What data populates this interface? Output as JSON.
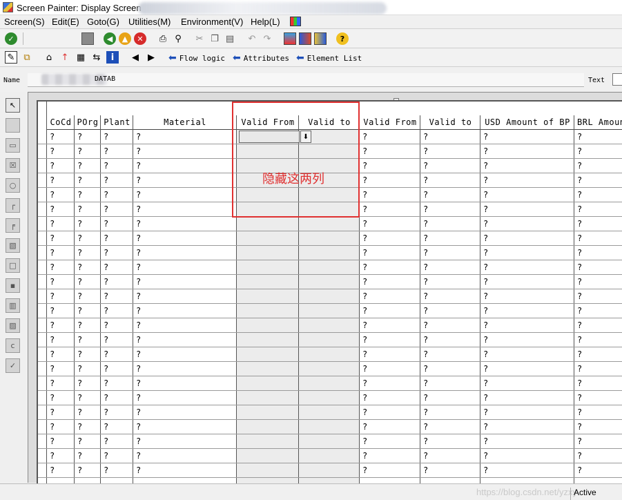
{
  "window": {
    "title": "Screen Painter: Display Screen"
  },
  "menu": [
    "Screen(S)",
    "Edit(E)",
    "Goto(G)",
    "Utilities(M)",
    "Environment(V)",
    "Help(L)"
  ],
  "toolbar2": {
    "flow_logic": "Flow logic",
    "attributes": "Attributes",
    "element_list": "Element List"
  },
  "nameline": {
    "label": "Name",
    "value": "DATAB",
    "text_label": "Text"
  },
  "table": {
    "columns": [
      "CoCd",
      "POrg",
      "Plant",
      "Material",
      "Valid From",
      "Valid to",
      "Valid From",
      "Valid to",
      "USD Amount of BP",
      "BRL Amount"
    ],
    "placeholder": "?",
    "row_count": 24,
    "hidden_columns_note": "隐藏这两列"
  },
  "status": {
    "active": "Active",
    "watermark": "https://blog.csdn.net/yzxy"
  },
  "icons": {
    "toolbar1": [
      "check-icon",
      "save-icon",
      "back-icon",
      "exit-icon",
      "cancel-icon",
      "print-icon",
      "find-icon",
      "cut-icon",
      "copy-icon",
      "paste-icon",
      "undo-icon",
      "redo-icon",
      "layout-icon",
      "display-icon",
      "graphic-icon",
      "help-icon"
    ],
    "palette": [
      "pointer-icon",
      "text-field-icon",
      "input-field-icon",
      "checkbox-icon",
      "radio-button-icon",
      "pushbutton-icon",
      "box-icon",
      "subscreen-icon",
      "tabstrip-icon",
      "custom-control-icon",
      "table-control-icon",
      "tabstrip-wizard-icon",
      "table-wizard-icon",
      "status-icon"
    ]
  },
  "colors": {
    "annotation": "#e03030",
    "accent_blue": "#1d4fb8"
  }
}
